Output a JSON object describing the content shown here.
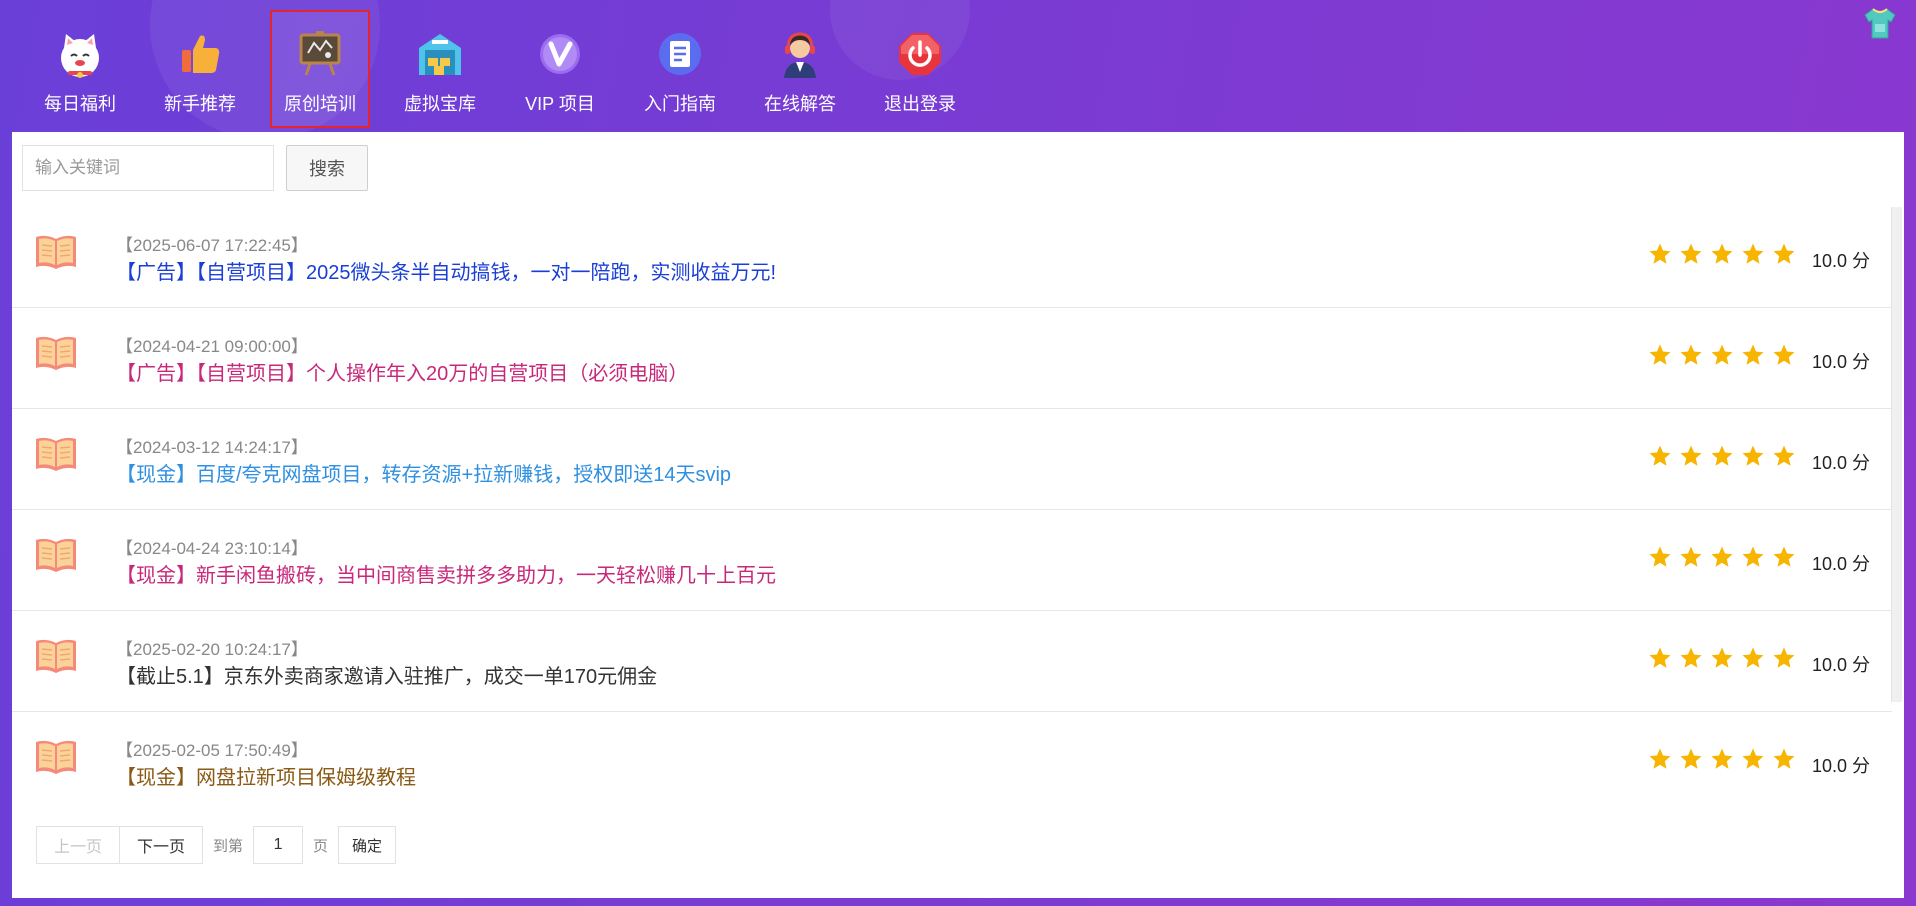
{
  "nav": {
    "items": [
      {
        "label": "每日福利",
        "icon": "lucky-cat-icon"
      },
      {
        "label": "新手推荐",
        "icon": "thumbs-up-icon"
      },
      {
        "label": "原创培训",
        "icon": "chalkboard-icon",
        "active": true
      },
      {
        "label": "虚拟宝库",
        "icon": "treasure-warehouse-icon"
      },
      {
        "label": "VIP 项目",
        "icon": "vip-badge-icon"
      },
      {
        "label": "入门指南",
        "icon": "guide-document-icon"
      },
      {
        "label": "在线解答",
        "icon": "support-agent-icon"
      },
      {
        "label": "退出登录",
        "icon": "power-off-icon"
      }
    ]
  },
  "header_right_icon": "tshirt-icon",
  "search": {
    "placeholder": "输入关键词",
    "button_label": "搜索"
  },
  "list": {
    "items": [
      {
        "date": "【2025-06-07 17:22:45】",
        "title": "【广告】【自营项目】2025微头条半自动搞钱，一对一陪跑，实测收益万元!",
        "color": "#1a3ed6",
        "rating": 5,
        "score": "10.0 分"
      },
      {
        "date": "【2024-04-21 09:00:00】",
        "title": "【广告】【自营项目】个人操作年入20万的自营项目（必须电脑）",
        "color": "#c8287a",
        "rating": 5,
        "score": "10.0 分"
      },
      {
        "date": "【2024-03-12 14:24:17】",
        "title": "【现金】百度/夸克网盘项目，转存资源+拉新赚钱，授权即送14天svip",
        "color": "#2f8fe0",
        "rating": 5,
        "score": "10.0 分"
      },
      {
        "date": "【2024-04-24 23:10:14】",
        "title": "【现金】新手闲鱼搬砖，当中间商售卖拼多多助力，一天轻松赚几十上百元",
        "color": "#c8287a",
        "rating": 5,
        "score": "10.0 分"
      },
      {
        "date": "【2025-02-20 10:24:17】",
        "title": "【截止5.1】京东外卖商家邀请入驻推广，成交一单170元佣金",
        "color": "#333333",
        "rating": 5,
        "score": "10.0 分"
      },
      {
        "date": "【2025-02-05 17:50:49】",
        "title": "【现金】网盘拉新项目保姆级教程",
        "color": "#8a5a14",
        "rating": 5,
        "score": "10.0 分"
      }
    ]
  },
  "pagination": {
    "prev": "上一页",
    "next": "下一页",
    "goto_prefix": "到第",
    "page_value": "1",
    "goto_suffix": "页",
    "confirm": "确定"
  },
  "colors": {
    "accent_purple": "#7a3bd3",
    "star": "#f7b500",
    "active_border": "#e2252e"
  }
}
